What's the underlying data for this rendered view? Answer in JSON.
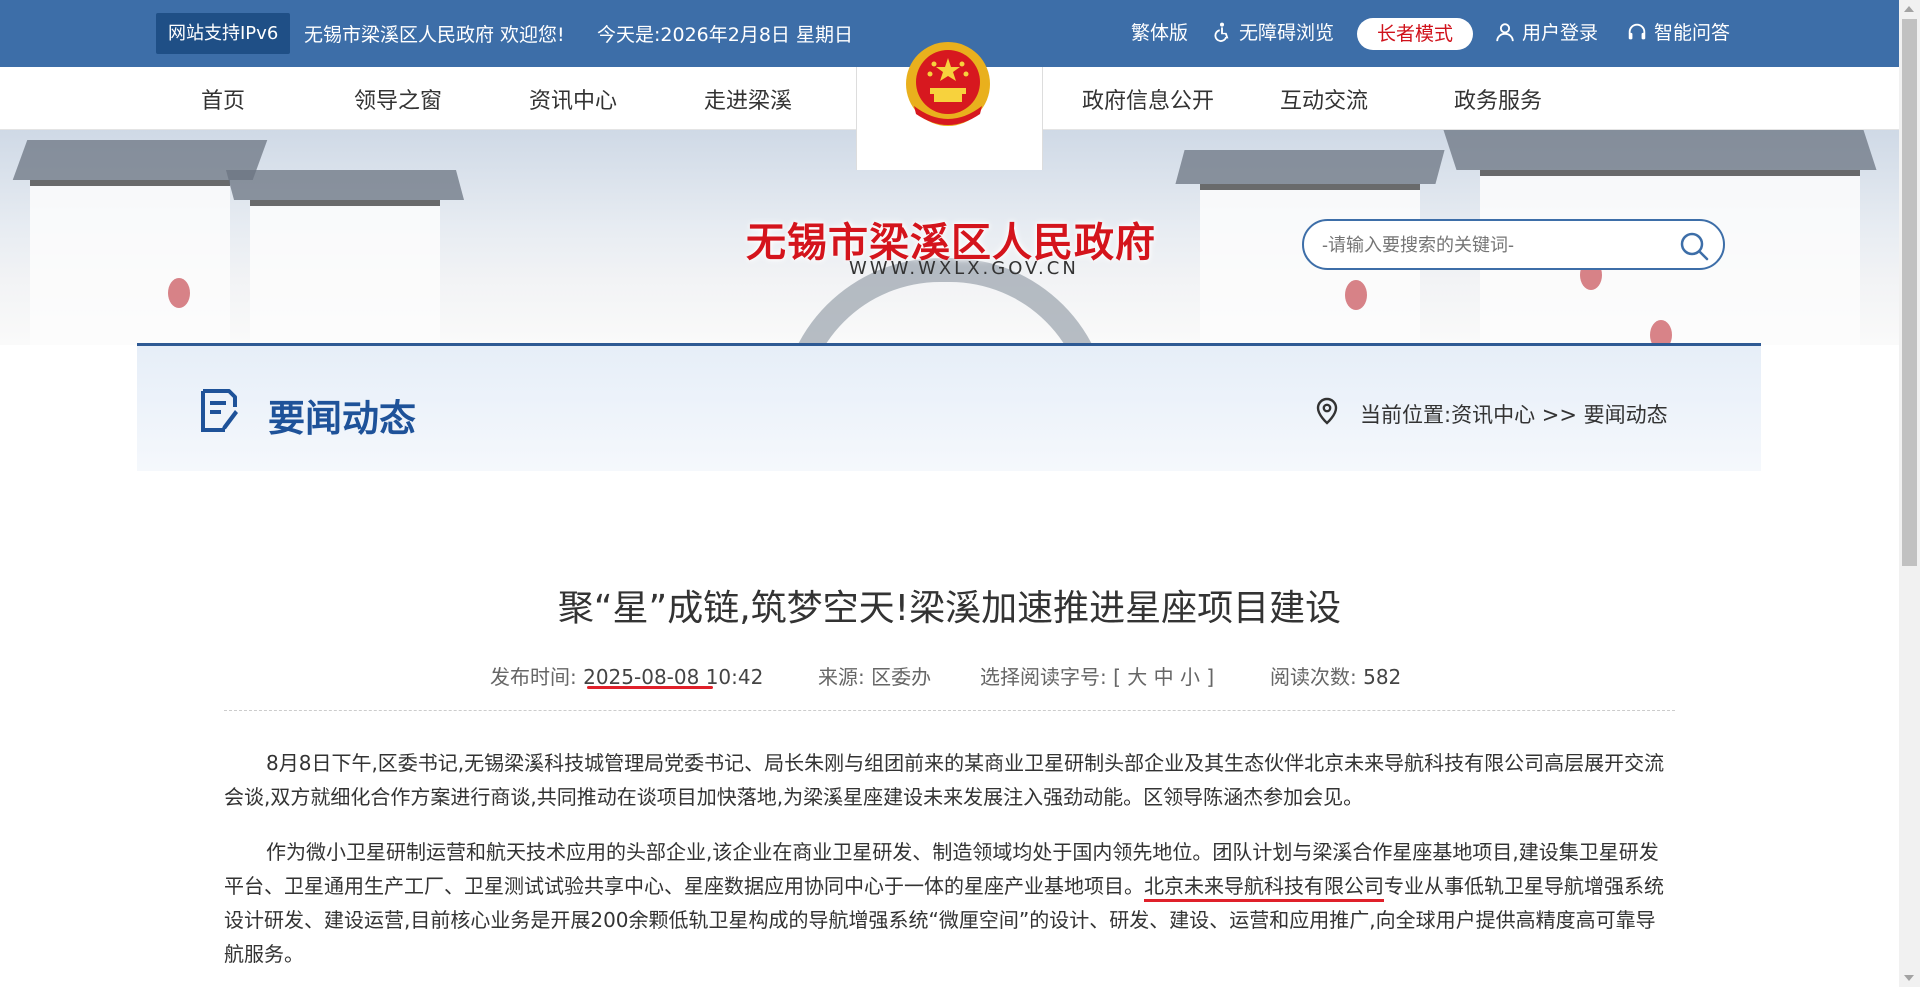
{
  "topbar": {
    "ipv6_badge": "网站支持IPv6",
    "welcome": "无锡市梁溪区人民政府 欢迎您!",
    "today": "今天是:2026年2月8日 星期日",
    "traditional": "繁体版",
    "accessibility": "无障碍浏览",
    "elder_mode": "长者模式",
    "login": "用户登录",
    "smart_qa": "智能问答"
  },
  "nav": {
    "items": [
      "首页",
      "领导之窗",
      "资讯中心",
      "走进梁溪",
      "政府信息公开",
      "互动交流",
      "政务服务"
    ]
  },
  "banner": {
    "site_title": "无锡市梁溪区人民政府",
    "site_url": "WWW.WXLX.GOV.CN",
    "search_placeholder": "-请输入要搜索的关键词-"
  },
  "section": {
    "title": "要闻动态",
    "breadcrumb": "当前位置:资讯中心 >> 要闻动态"
  },
  "article": {
    "title": "聚“星”成链,筑梦空天!梁溪加速推进星座项目建设",
    "publish_label": "发布时间:",
    "publish_date": "2025-08-08",
    "publish_time": "10:42",
    "source_label": "来源:",
    "source": "区委办",
    "fontsize_label": "选择阅读字号:",
    "fontsize_options": "[ 大 中 小 ]",
    "views_label": "阅读次数:",
    "views": "582",
    "paragraph1": "8月8日下午,区委书记,无锡梁溪科技城管理局党委书记、局长朱刚与组团前来的某商业卫星研制头部企业及其生态伙伴北京未来导航科技有限公司高层展开交流会谈,双方就细化合作方案进行商谈,共同推动在谈项目加快落地,为梁溪星座建设未来发展注入强劲动能。区领导陈涵杰参加会见。",
    "paragraph2_a": "作为微小卫星研制运营和航天技术应用的头部企业,该企业在商业卫星研发、制造领域均处于国内领先地位。团队计划与梁溪合作星座基地项目,建设集卫星研发平台、卫星通用生产工厂、卫星测试试验共享中心、星座数据应用协同中心于一体的星座产业基地项目。",
    "paragraph2_highlight": "北京未来导航科技有限公司",
    "paragraph2_b": "专业从事低轨卫星导航增强系统设计研发、建设运营,目前核心业务是开展200余颗低轨卫星构成的导航增强系统“微厘空间”的设计、研发、建设、运营和应用推广,向全球用户提供高精度高可靠导航服务。"
  },
  "colors": {
    "topbar_blue": "#3d6ea8",
    "title_red": "#d4141c",
    "section_blue": "#1e5299",
    "highlight_red": "#e0202a"
  },
  "icons": [
    "accessibility-icon",
    "user-icon",
    "headset-icon",
    "search-icon",
    "document-icon",
    "location-pin-icon",
    "national-emblem"
  ]
}
